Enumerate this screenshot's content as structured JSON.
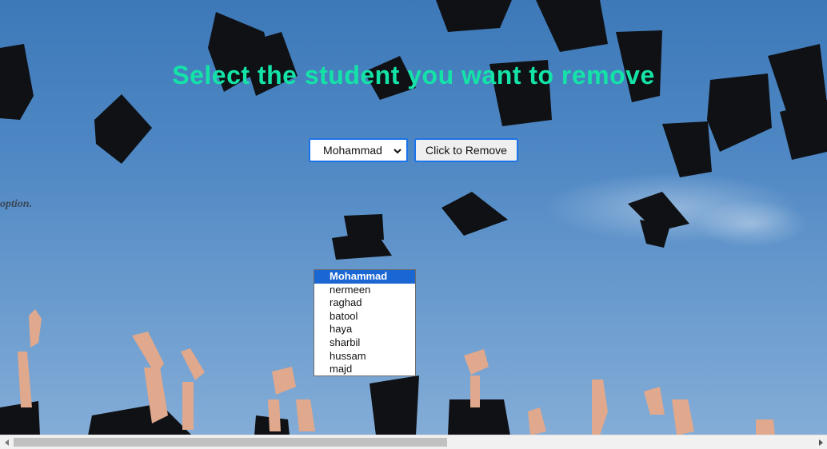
{
  "page": {
    "title": "Select the student you want to remove",
    "side_text": "option."
  },
  "form": {
    "selected_student": "Mohammad",
    "remove_button_label": "Click to Remove"
  },
  "dropdown": {
    "options": [
      "Mohammad",
      "nermeen",
      "raghad",
      "batool",
      "haya",
      "sharbil",
      "hussam",
      "majd"
    ],
    "highlighted_index": 0
  },
  "scrollbar": {
    "left_icon": "arrow-left-icon",
    "right_icon": "arrow-right-icon"
  },
  "colors": {
    "title": "#14e3a8",
    "focus_border": "#1a73e8",
    "highlight": "#1a66d2"
  }
}
